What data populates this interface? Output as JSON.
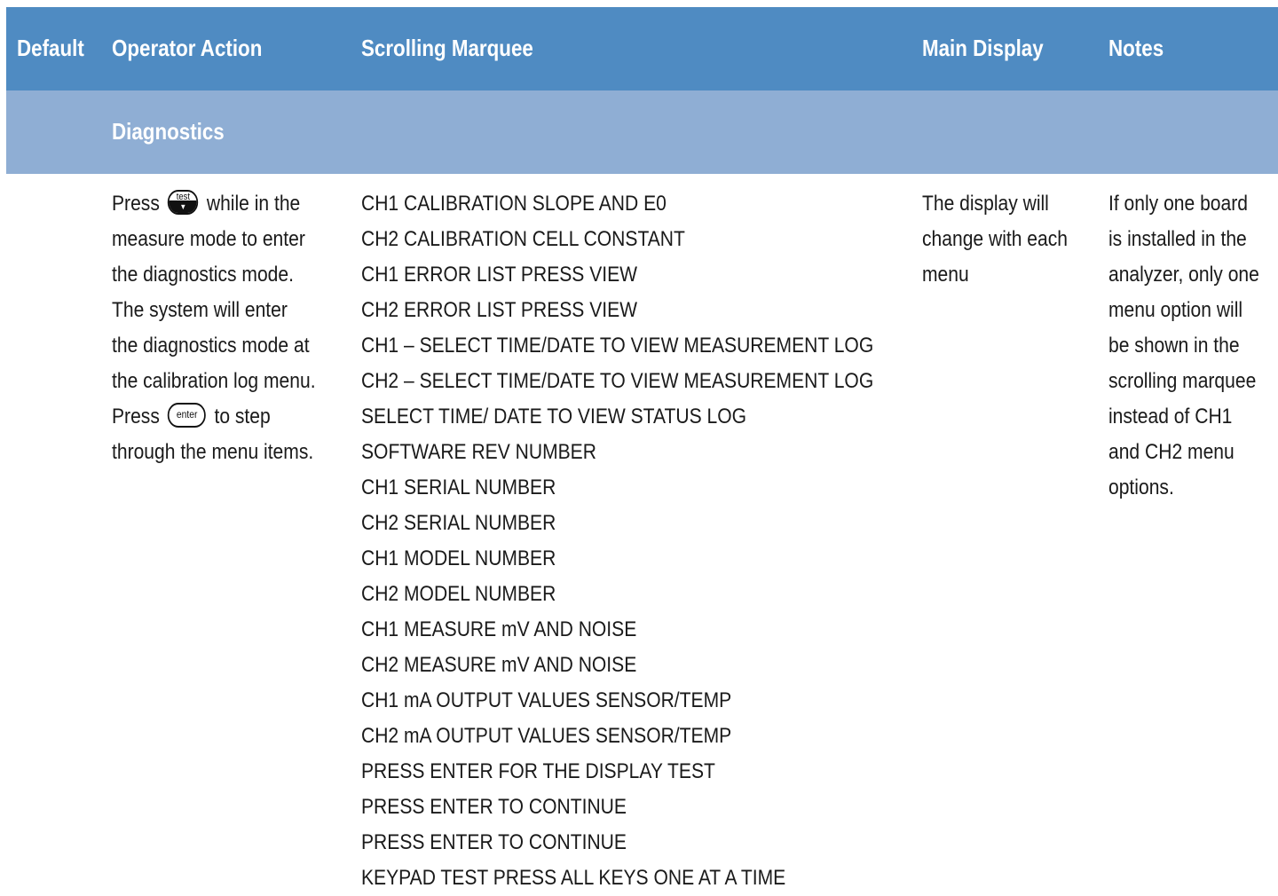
{
  "header": {
    "default": "Default",
    "operator_action": "Operator Action",
    "scrolling_marquee": "Scrolling Marquee",
    "main_display": "Main Display",
    "notes": "Notes"
  },
  "section": {
    "title": "Diagnostics"
  },
  "operator": {
    "line1_a": "Press",
    "line1_b": "while in the",
    "line2": "measure mode to enter",
    "line3": "the diagnostics mode.",
    "line4": "The system will enter",
    "line5": "the diagnostics mode at",
    "line6": "the calibration log menu.",
    "line7_a": "Press",
    "line7_b": "to step",
    "line8": "through the menu items.",
    "key_test_label": "test",
    "key_test_arrow": "▼",
    "key_enter_label": "enter"
  },
  "marquee": [
    "CH1 CALIBRATION SLOPE AND E0",
    "CH2 CALIBRATION CELL CONSTANT",
    "CH1 ERROR LIST PRESS VIEW",
    "CH2 ERROR LIST PRESS VIEW",
    "CH1 – SELECT TIME/DATE TO VIEW MEASUREMENT LOG",
    "CH2 – SELECT TIME/DATE TO VIEW MEASUREMENT LOG",
    "SELECT TIME/ DATE TO VIEW STATUS LOG",
    "SOFTWARE REV NUMBER",
    "CH1 SERIAL NUMBER",
    "CH2 SERIAL NUMBER",
    "CH1 MODEL NUMBER",
    "CH2 MODEL NUMBER",
    "CH1 MEASURE mV AND NOISE",
    "CH2 MEASURE mV AND NOISE",
    "CH1 mA OUTPUT VALUES SENSOR/TEMP",
    "CH2 mA OUTPUT VALUES SENSOR/TEMP",
    "PRESS ENTER FOR THE DISPLAY TEST",
    "PRESS ENTER TO CONTINUE",
    "PRESS ENTER TO CONTINUE",
    "KEYPAD TEST PRESS ALL KEYS ONE AT A TIME"
  ],
  "main_display": [
    "The display will",
    "change with each",
    "menu"
  ],
  "notes": [
    "If only one board",
    "is installed in the",
    "analyzer, only one",
    "menu option will",
    "be shown in the",
    "scrolling marquee",
    "instead of CH1",
    "and CH2 menu",
    "options."
  ],
  "colors": {
    "header": "#4f8bc2",
    "section": "#8faed4"
  }
}
